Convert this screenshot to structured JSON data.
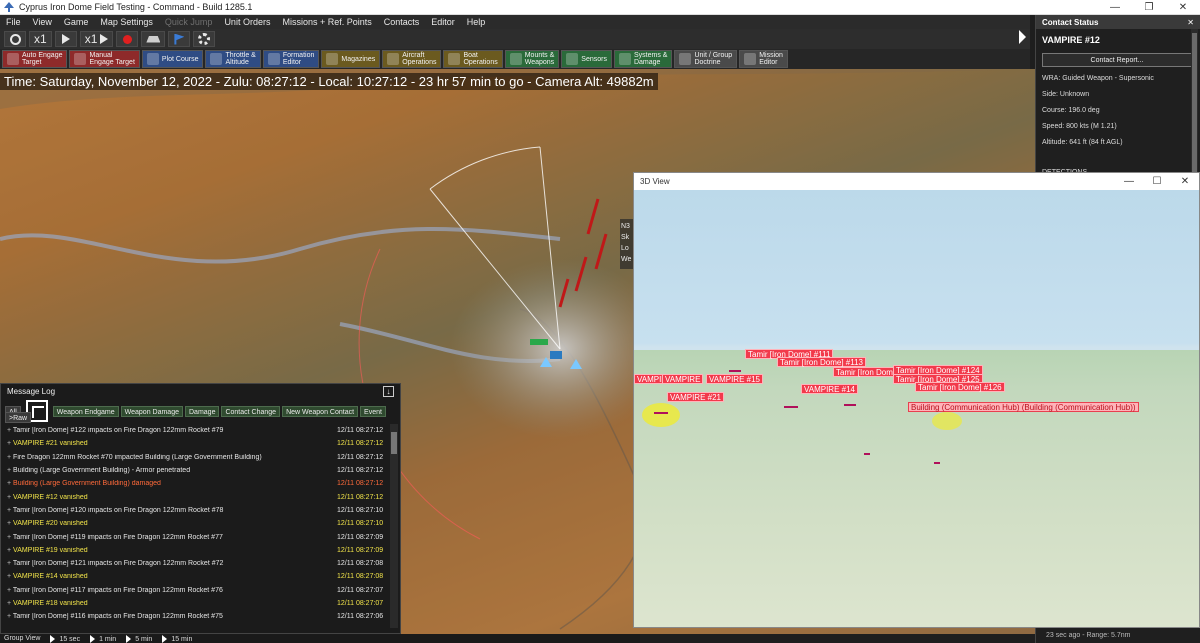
{
  "window": {
    "title": "Cyprus Iron Dome Field Testing - Command - Build 1285.1"
  },
  "menu": [
    "File",
    "View",
    "Game",
    "Map Settings",
    "Quick Jump",
    "Unit Orders",
    "Missions + Ref. Points",
    "Contacts",
    "Editor",
    "Help"
  ],
  "toolbar": {
    "speed1": "x1",
    "speed2": "x1"
  },
  "commands": [
    {
      "l1": "Auto Engage",
      "l2": "Target",
      "color": "#8e2a2a"
    },
    {
      "l1": "Manual",
      "l2": "Engage Target",
      "color": "#8e2a2a"
    },
    {
      "l1": "Plot Course",
      "l2": "",
      "color": "#2f4c84"
    },
    {
      "l1": "Throttle &",
      "l2": "Altitude",
      "color": "#2f4c84"
    },
    {
      "l1": "Formation",
      "l2": "Editor",
      "color": "#2f4c84"
    },
    {
      "l1": "Magazines",
      "l2": "",
      "color": "#6b5a1f"
    },
    {
      "l1": "Aircraft",
      "l2": "Operations",
      "color": "#6b5a1f"
    },
    {
      "l1": "Boat",
      "l2": "Operations",
      "color": "#6b5a1f"
    },
    {
      "l1": "Mounts &",
      "l2": "Weapons",
      "color": "#2a6a3a"
    },
    {
      "l1": "Sensors",
      "l2": "",
      "color": "#2a6a3a"
    },
    {
      "l1": "Systems &",
      "l2": "Damage",
      "color": "#2a6a3a"
    },
    {
      "l1": "Unit / Group",
      "l2": "Doctrine",
      "color": "#4a4a4a"
    },
    {
      "l1": "Mission",
      "l2": "Editor",
      "color": "#4a4a4a"
    }
  ],
  "time_bar": "Time: Saturday, November 12, 2022 - Zulu: 08:27:12 - Local: 10:27:12 - 23 hr 57 min to go -  Camera Alt: 49882m",
  "message_log": {
    "title": "Message Log",
    "filters": [
      "All",
      "Weapon Endgame",
      "Weapon Damage",
      "Damage",
      "Contact Change",
      "New Weapon Contact",
      "Event"
    ],
    "raw": ">Raw",
    "rows": [
      {
        "text": "Tamir [Iron Dome] #122 impacts on Fire Dragon 122mm Rocket #79",
        "time": "12/11 08:27:12",
        "kind": "normal"
      },
      {
        "text": "VAMPIRE #21 vanished",
        "time": "12/11 08:27:12",
        "kind": "yellow"
      },
      {
        "text": "Fire Dragon 122mm Rocket #70 impacted Building (Large Government Building)",
        "time": "12/11 08:27:12",
        "kind": "normal"
      },
      {
        "text": "Building (Large Government Building) - Armor penetrated",
        "time": "12/11 08:27:12",
        "kind": "normal"
      },
      {
        "text": "Building (Large Government Building) damaged",
        "time": "12/11 08:27:12",
        "kind": "red"
      },
      {
        "text": "VAMPIRE #12 vanished",
        "time": "12/11 08:27:12",
        "kind": "yellow"
      },
      {
        "text": "Tamir [Iron Dome] #120 impacts on Fire Dragon 122mm Rocket #78",
        "time": "12/11 08:27:10",
        "kind": "normal"
      },
      {
        "text": "VAMPIRE #20 vanished",
        "time": "12/11 08:27:10",
        "kind": "yellow"
      },
      {
        "text": "Tamir [Iron Dome] #119 impacts on Fire Dragon 122mm Rocket #77",
        "time": "12/11 08:27:09",
        "kind": "normal"
      },
      {
        "text": "VAMPIRE #19 vanished",
        "time": "12/11 08:27:09",
        "kind": "yellow"
      },
      {
        "text": "Tamir [Iron Dome] #121 impacts on Fire Dragon 122mm Rocket #72",
        "time": "12/11 08:27:08",
        "kind": "normal"
      },
      {
        "text": "VAMPIRE #14 vanished",
        "time": "12/11 08:27:08",
        "kind": "yellow"
      },
      {
        "text": "Tamir [Iron Dome] #117 impacts on Fire Dragon 122mm Rocket #76",
        "time": "12/11 08:27:07",
        "kind": "normal"
      },
      {
        "text": "VAMPIRE #18 vanished",
        "time": "12/11 08:27:07",
        "kind": "yellow"
      },
      {
        "text": "Tamir [Iron Dome] #116 impacts on Fire Dragon 122mm Rocket #75",
        "time": "12/11 08:27:06",
        "kind": "normal"
      }
    ]
  },
  "bottom_bar": {
    "label": "Group View",
    "steps": [
      "15 sec",
      "1 min",
      "5 min",
      "15 min"
    ]
  },
  "contact_status": {
    "header": "Contact Status",
    "name": "VAMPIRE #12",
    "report_button": "Contact Report...",
    "details": [
      "WRA: Guided Weapon - Supersonic",
      "Side: Unknown",
      "Course: 196.0 deg",
      "Speed: 800 kts (M 1.21)",
      "Altitude: 641 ft (84 ft AGL)"
    ],
    "detections_label": "DETECTIONS",
    "footer": "23 sec ago  -  Range: 5.7nm"
  },
  "view3d": {
    "title": "3D View",
    "tags": [
      {
        "text": "Tamir [Iron Dome] #111",
        "kind": "unit"
      },
      {
        "text": "Tamir [Iron Dome] #113",
        "kind": "unit"
      },
      {
        "text": "Tamir [Iron Dome] #123",
        "kind": "unit"
      },
      {
        "text": "Tamir [Iron Dome] #124",
        "kind": "unit"
      },
      {
        "text": "Tamir [Iron Dome] #125",
        "kind": "unit"
      },
      {
        "text": "Tamir [Iron Dome] #126",
        "kind": "unit"
      },
      {
        "text": "VAMPIRE #15",
        "kind": "unit"
      },
      {
        "text": "VAMPIRE #14",
        "kind": "unit"
      },
      {
        "text": "VAMPIRE #21",
        "kind": "unit"
      },
      {
        "text": "VAMPIRE",
        "kind": "unit"
      },
      {
        "text": "VAMPIRE",
        "kind": "unit"
      },
      {
        "text": "Building (Communication Hub) (Building (Communication Hub))",
        "kind": "target"
      }
    ]
  },
  "map_labels": {
    "info1": "N3",
    "info2": "Sk",
    "info3": "Lo",
    "info4": "We"
  }
}
